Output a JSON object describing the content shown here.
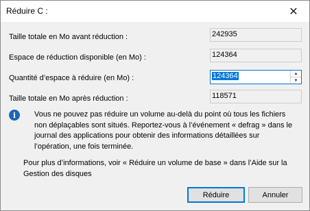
{
  "window": {
    "title": "Réduire C :"
  },
  "fields": {
    "total_before": {
      "label": "Taille totale en Mo avant réduction :",
      "value": "242935"
    },
    "available": {
      "label": "Espace de réduction disponible (en Mo) :",
      "value": "124364"
    },
    "shrink_amount": {
      "label": "Quantité d’espace à réduire (en Mo) :",
      "value": "124364"
    },
    "total_after": {
      "label": "Taille totale en Mo après réduction :",
      "value": "118571"
    }
  },
  "info": {
    "text": "Vous ne pouvez pas réduire un volume au-delà du point où tous les fichiers non déplaçables sont situés. Reportez-vous à l’événement « defrag » dans le journal des applications pour obtenir des informations détaillées sur l’opération, une fois terminée.",
    "more": "Pour plus d’informations, voir « Réduire un volume de base » dans l’Aide sur la Gestion des disques"
  },
  "buttons": {
    "reduce": "Réduire",
    "cancel": "Annuler"
  },
  "icons": {
    "close": "close-icon",
    "info": "info-icon",
    "spin_up": "chevron-up-icon",
    "spin_down": "chevron-down-icon"
  },
  "colors": {
    "accent": "#0078d7",
    "info_icon": "#1a66b8"
  }
}
